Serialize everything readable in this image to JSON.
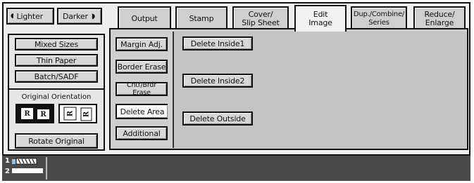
{
  "density": {
    "lighter_label": "Lighter",
    "darker_label": "Darker"
  },
  "tabs": [
    {
      "label": "Output"
    },
    {
      "label": "Stamp"
    },
    {
      "label": "Cover/\nSlip Sheet"
    },
    {
      "label": "Edit\nImage",
      "active": true
    },
    {
      "label": "Dup./Combine/\nSeries"
    },
    {
      "label": "Reduce/\nEnlarge"
    }
  ],
  "paper_type": {
    "mixed_sizes": "Mixed Sizes",
    "thin_paper": "Thin Paper",
    "batch_sadf": "Batch/SADF"
  },
  "orientation": {
    "title": "Original Orientation",
    "portrait_letter": "R",
    "landscape_letter": "R",
    "rotate_label": "Rotate Original"
  },
  "edit_menu": {
    "margin_adj": "Margin Adj.",
    "border_erase": "Border Erase",
    "cntr_brdr_erase": "Cntr/Brdr Erase",
    "delete_area": "Delete Area",
    "additional": "Additional"
  },
  "delete_options": {
    "inside1": "Delete Inside1",
    "inside2": "Delete Inside2",
    "outside": "Delete Outside"
  },
  "status_bar": {
    "tray1": "1",
    "tray2": "2"
  },
  "colors": {
    "frame": "#111111",
    "panel": "#cfcfcf",
    "status_bar": "#4a4a4a",
    "button": "#d7d7d7"
  }
}
